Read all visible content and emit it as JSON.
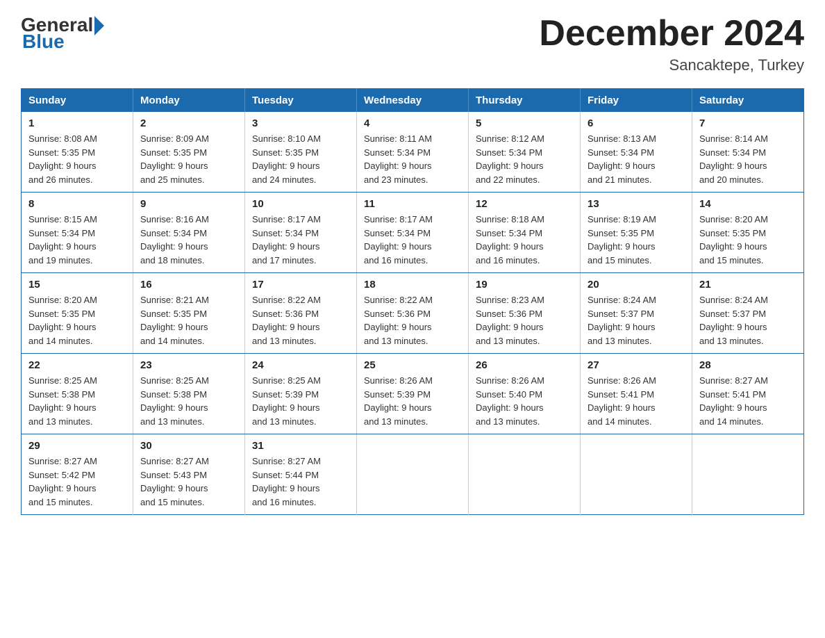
{
  "logo": {
    "general": "General",
    "blue": "Blue"
  },
  "header": {
    "month_title": "December 2024",
    "location": "Sancaktepe, Turkey"
  },
  "weekdays": [
    "Sunday",
    "Monday",
    "Tuesday",
    "Wednesday",
    "Thursday",
    "Friday",
    "Saturday"
  ],
  "weeks": [
    [
      {
        "day": "1",
        "sunrise": "8:08 AM",
        "sunset": "5:35 PM",
        "daylight": "9 hours and 26 minutes."
      },
      {
        "day": "2",
        "sunrise": "8:09 AM",
        "sunset": "5:35 PM",
        "daylight": "9 hours and 25 minutes."
      },
      {
        "day": "3",
        "sunrise": "8:10 AM",
        "sunset": "5:35 PM",
        "daylight": "9 hours and 24 minutes."
      },
      {
        "day": "4",
        "sunrise": "8:11 AM",
        "sunset": "5:34 PM",
        "daylight": "9 hours and 23 minutes."
      },
      {
        "day": "5",
        "sunrise": "8:12 AM",
        "sunset": "5:34 PM",
        "daylight": "9 hours and 22 minutes."
      },
      {
        "day": "6",
        "sunrise": "8:13 AM",
        "sunset": "5:34 PM",
        "daylight": "9 hours and 21 minutes."
      },
      {
        "day": "7",
        "sunrise": "8:14 AM",
        "sunset": "5:34 PM",
        "daylight": "9 hours and 20 minutes."
      }
    ],
    [
      {
        "day": "8",
        "sunrise": "8:15 AM",
        "sunset": "5:34 PM",
        "daylight": "9 hours and 19 minutes."
      },
      {
        "day": "9",
        "sunrise": "8:16 AM",
        "sunset": "5:34 PM",
        "daylight": "9 hours and 18 minutes."
      },
      {
        "day": "10",
        "sunrise": "8:17 AM",
        "sunset": "5:34 PM",
        "daylight": "9 hours and 17 minutes."
      },
      {
        "day": "11",
        "sunrise": "8:17 AM",
        "sunset": "5:34 PM",
        "daylight": "9 hours and 16 minutes."
      },
      {
        "day": "12",
        "sunrise": "8:18 AM",
        "sunset": "5:34 PM",
        "daylight": "9 hours and 16 minutes."
      },
      {
        "day": "13",
        "sunrise": "8:19 AM",
        "sunset": "5:35 PM",
        "daylight": "9 hours and 15 minutes."
      },
      {
        "day": "14",
        "sunrise": "8:20 AM",
        "sunset": "5:35 PM",
        "daylight": "9 hours and 15 minutes."
      }
    ],
    [
      {
        "day": "15",
        "sunrise": "8:20 AM",
        "sunset": "5:35 PM",
        "daylight": "9 hours and 14 minutes."
      },
      {
        "day": "16",
        "sunrise": "8:21 AM",
        "sunset": "5:35 PM",
        "daylight": "9 hours and 14 minutes."
      },
      {
        "day": "17",
        "sunrise": "8:22 AM",
        "sunset": "5:36 PM",
        "daylight": "9 hours and 13 minutes."
      },
      {
        "day": "18",
        "sunrise": "8:22 AM",
        "sunset": "5:36 PM",
        "daylight": "9 hours and 13 minutes."
      },
      {
        "day": "19",
        "sunrise": "8:23 AM",
        "sunset": "5:36 PM",
        "daylight": "9 hours and 13 minutes."
      },
      {
        "day": "20",
        "sunrise": "8:24 AM",
        "sunset": "5:37 PM",
        "daylight": "9 hours and 13 minutes."
      },
      {
        "day": "21",
        "sunrise": "8:24 AM",
        "sunset": "5:37 PM",
        "daylight": "9 hours and 13 minutes."
      }
    ],
    [
      {
        "day": "22",
        "sunrise": "8:25 AM",
        "sunset": "5:38 PM",
        "daylight": "9 hours and 13 minutes."
      },
      {
        "day": "23",
        "sunrise": "8:25 AM",
        "sunset": "5:38 PM",
        "daylight": "9 hours and 13 minutes."
      },
      {
        "day": "24",
        "sunrise": "8:25 AM",
        "sunset": "5:39 PM",
        "daylight": "9 hours and 13 minutes."
      },
      {
        "day": "25",
        "sunrise": "8:26 AM",
        "sunset": "5:39 PM",
        "daylight": "9 hours and 13 minutes."
      },
      {
        "day": "26",
        "sunrise": "8:26 AM",
        "sunset": "5:40 PM",
        "daylight": "9 hours and 13 minutes."
      },
      {
        "day": "27",
        "sunrise": "8:26 AM",
        "sunset": "5:41 PM",
        "daylight": "9 hours and 14 minutes."
      },
      {
        "day": "28",
        "sunrise": "8:27 AM",
        "sunset": "5:41 PM",
        "daylight": "9 hours and 14 minutes."
      }
    ],
    [
      {
        "day": "29",
        "sunrise": "8:27 AM",
        "sunset": "5:42 PM",
        "daylight": "9 hours and 15 minutes."
      },
      {
        "day": "30",
        "sunrise": "8:27 AM",
        "sunset": "5:43 PM",
        "daylight": "9 hours and 15 minutes."
      },
      {
        "day": "31",
        "sunrise": "8:27 AM",
        "sunset": "5:44 PM",
        "daylight": "9 hours and 16 minutes."
      },
      null,
      null,
      null,
      null
    ]
  ],
  "labels": {
    "sunrise": "Sunrise:",
    "sunset": "Sunset:",
    "daylight": "Daylight:"
  }
}
